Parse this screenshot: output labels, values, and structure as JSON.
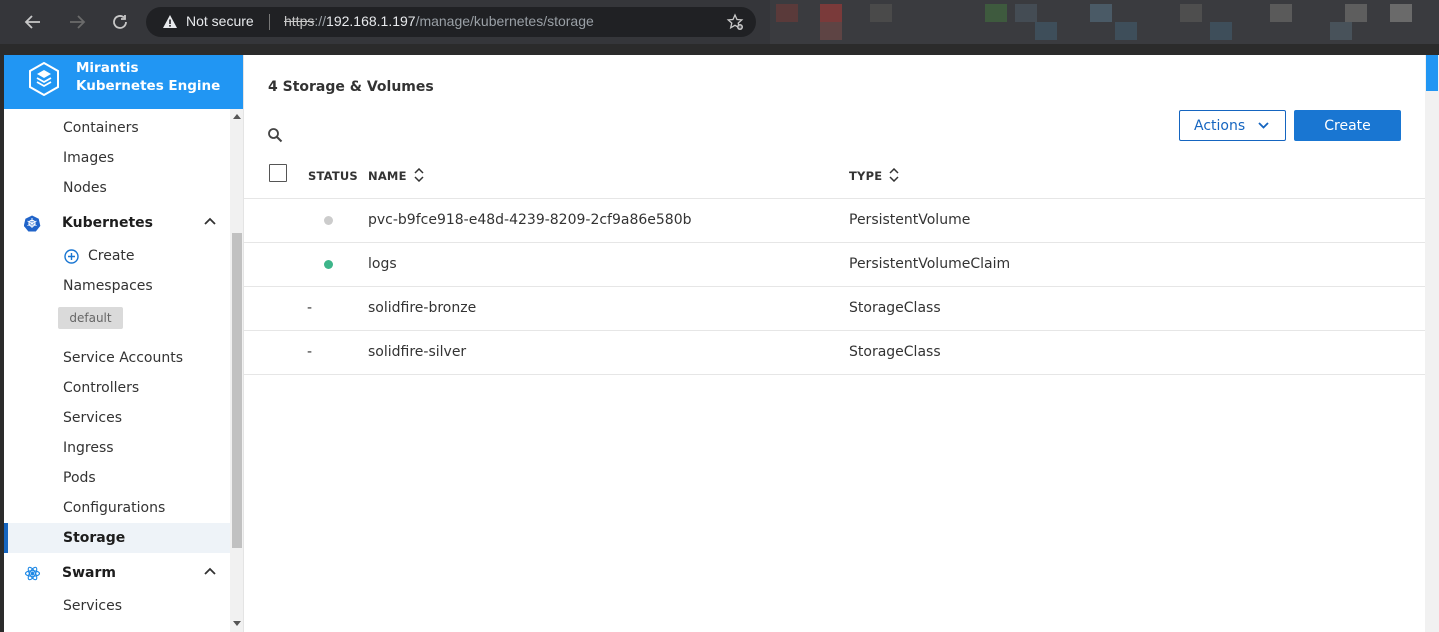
{
  "browser": {
    "security_label": "Not secure",
    "url_scheme": "https",
    "url_sep": "://",
    "url_host": "192.168.1.197",
    "url_path": "/manage/kubernetes/storage"
  },
  "brand": {
    "line1": "Mirantis",
    "line2": "Kubernetes Engine",
    "color": "#2196f3"
  },
  "sidebar": {
    "items": [
      {
        "label": "Containers"
      },
      {
        "label": "Images"
      },
      {
        "label": "Nodes"
      }
    ],
    "kubernetes": {
      "label": "Kubernetes",
      "create_label": "Create",
      "namespaces_label": "Namespaces",
      "namespace_badge": "default",
      "items": [
        {
          "label": "Service Accounts"
        },
        {
          "label": "Controllers"
        },
        {
          "label": "Services"
        },
        {
          "label": "Ingress"
        },
        {
          "label": "Pods"
        },
        {
          "label": "Configurations"
        },
        {
          "label": "Storage"
        }
      ]
    },
    "swarm": {
      "label": "Swarm",
      "items": [
        {
          "label": "Services"
        }
      ]
    }
  },
  "main": {
    "title": "4 Storage & Volumes",
    "actions_label": "Actions",
    "create_label": "Create",
    "table": {
      "headers": {
        "status": "STATUS",
        "name": "NAME",
        "type": "TYPE"
      },
      "rows": [
        {
          "status": "inactive",
          "status_color": "#cccccc",
          "name": "pvc-b9fce918-e48d-4239-8209-2cf9a86e580b",
          "type": "PersistentVolume"
        },
        {
          "status": "active",
          "status_color": "#3db58a",
          "name": "logs",
          "type": "PersistentVolumeClaim"
        },
        {
          "status": "-",
          "name": "solidfire-bronze",
          "type": "StorageClass"
        },
        {
          "status": "-",
          "name": "solidfire-silver",
          "type": "StorageClass"
        }
      ]
    }
  }
}
